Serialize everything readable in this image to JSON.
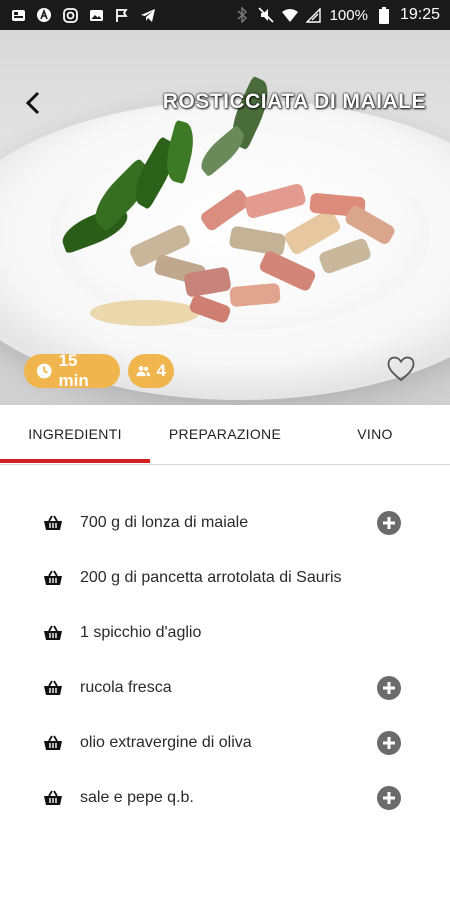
{
  "status_bar": {
    "battery": "100%",
    "time": "19:25",
    "left_icons": [
      "gallery-icon",
      "app-a-icon",
      "instagram-icon",
      "image-icon",
      "flag-icon",
      "telegram-icon"
    ],
    "right_icons": [
      "bluetooth-icon",
      "mute-icon",
      "wifi-icon",
      "signal-icon",
      "battery-icon"
    ]
  },
  "header": {
    "title": "ROSTICCIATA DI MAIALE"
  },
  "info": {
    "time": "15 min",
    "people": "4"
  },
  "tabs": [
    {
      "label": "INGREDIENTI",
      "active": true
    },
    {
      "label": "PREPARAZIONE",
      "active": false
    },
    {
      "label": "VINO",
      "active": false
    }
  ],
  "ingredients": [
    {
      "text": "700 g di  lonza di maiale",
      "has_add": true
    },
    {
      "text": "200 g di  pancetta arrotolata di Sauris",
      "has_add": false
    },
    {
      "text": "1 spicchio  d'aglio",
      "has_add": false
    },
    {
      "text": "rucola  fresca",
      "has_add": true
    },
    {
      "text": "olio extravergine  di oliva",
      "has_add": true
    },
    {
      "text": "sale e  pepe q.b.",
      "has_add": true
    }
  ],
  "colors": {
    "accent": "#d21f1f",
    "chip": "#f1b54d"
  }
}
